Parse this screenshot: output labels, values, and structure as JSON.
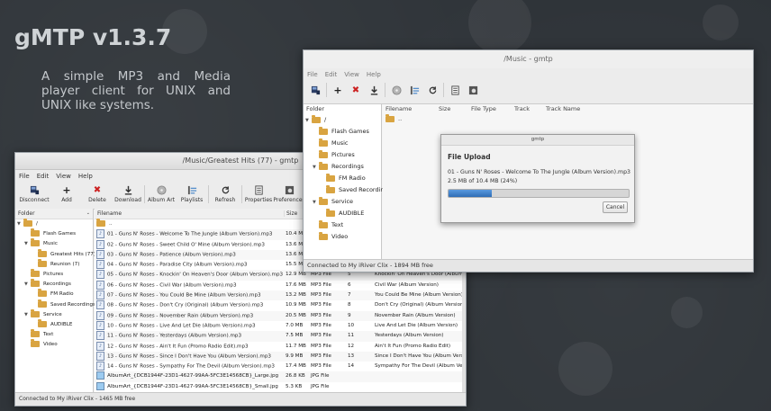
{
  "app": {
    "title": "gMTP v1.3.7",
    "description": "A simple MP3 and Media player client for UNIX and UNIX like systems."
  },
  "colors": {
    "accent": "#3d7fc6",
    "background": "#2e3338",
    "folder": "#d9a441",
    "delete": "#cc2222"
  },
  "window_large": {
    "title": "/Music/Greatest Hits (77) - gmtp",
    "menu": [
      "File",
      "Edit",
      "View",
      "Help"
    ],
    "toolbar": [
      {
        "label": "Disconnect",
        "icon": "disconnect-icon"
      },
      {
        "label": "Add",
        "icon": "add-icon"
      },
      {
        "label": "Delete",
        "icon": "delete-icon"
      },
      {
        "label": "Download",
        "icon": "download-icon"
      },
      {
        "label": "Album Art",
        "icon": "album-art-icon"
      },
      {
        "label": "Playlists",
        "icon": "playlists-icon"
      },
      {
        "label": "Refresh",
        "icon": "refresh-icon"
      },
      {
        "label": "Properties",
        "icon": "properties-icon"
      },
      {
        "label": "Preferences",
        "icon": "preferences-icon"
      }
    ],
    "folder_header": "Folder",
    "folders": [
      {
        "label": "/",
        "level": 0,
        "expanded": true
      },
      {
        "label": "Flash Games",
        "level": 1
      },
      {
        "label": "Music",
        "level": 1,
        "expanded": true
      },
      {
        "label": "Greatest Hits (77)",
        "level": 2
      },
      {
        "label": "Reunion (7)",
        "level": 2
      },
      {
        "label": "Pictures",
        "level": 1
      },
      {
        "label": "Recordings",
        "level": 1,
        "expanded": true
      },
      {
        "label": "FM Radio",
        "level": 2
      },
      {
        "label": "Saved Recordings",
        "level": 2
      },
      {
        "label": "Service",
        "level": 1,
        "expanded": true
      },
      {
        "label": "AUDIBLE",
        "level": 2
      },
      {
        "label": "Text",
        "level": 1
      },
      {
        "label": "Video",
        "level": 1
      }
    ],
    "columns": [
      "Filename",
      "Size"
    ],
    "files": [
      {
        "name": "..",
        "size": "",
        "type": "",
        "track": "",
        "title": "",
        "kind": "folder"
      },
      {
        "name": "01 - Guns N' Roses - Welcome To The Jungle (Album Version).mp3",
        "size": "10.4 MB",
        "type": "",
        "track": "",
        "title": "",
        "kind": "music"
      },
      {
        "name": "02 - Guns N' Roses - Sweet Child O' Mine (Album Version).mp3",
        "size": "13.6 MB",
        "type": "",
        "track": "",
        "title": "",
        "kind": "music"
      },
      {
        "name": "03 - Guns N' Roses - Patience (Album Version).mp3",
        "size": "13.6 MB",
        "type": "",
        "track": "",
        "title": "",
        "kind": "music"
      },
      {
        "name": "04 - Guns N' Roses - Paradise City (Album Version).mp3",
        "size": "15.5 MB",
        "type": "",
        "track": "",
        "title": "",
        "kind": "music"
      },
      {
        "name": "05 - Guns N' Roses - Knockin' On Heaven's Door (Album Version).mp3",
        "size": "12.9 MB",
        "type": "MP3 File",
        "track": "5",
        "title": "Knockin' On Heaven's Door (Album Version)",
        "kind": "music"
      },
      {
        "name": "06 - Guns N' Roses - Civil War (Album Version).mp3",
        "size": "17.6 MB",
        "type": "MP3 File",
        "track": "6",
        "title": "Civil War (Album Version)",
        "kind": "music"
      },
      {
        "name": "07 - Guns N' Roses - You Could Be Mine (Album Version).mp3",
        "size": "13.2 MB",
        "type": "MP3 File",
        "track": "7",
        "title": "You Could Be Mine (Album Version)",
        "kind": "music"
      },
      {
        "name": "08 - Guns N' Roses - Don't Cry (Original) (Album Version).mp3",
        "size": "10.9 MB",
        "type": "MP3 File",
        "track": "8",
        "title": "Don't Cry (Original) (Album Version)",
        "kind": "music"
      },
      {
        "name": "09 - Guns N' Roses - November Rain (Album Version).mp3",
        "size": "20.5 MB",
        "type": "MP3 File",
        "track": "9",
        "title": "November Rain (Album Version)",
        "kind": "music"
      },
      {
        "name": "10 - Guns N' Roses - Live And Let Die (Album Version).mp3",
        "size": "7.0 MB",
        "type": "MP3 File",
        "track": "10",
        "title": "Live And Let Die (Album Version)",
        "kind": "music"
      },
      {
        "name": "11 - Guns N' Roses - Yesterdays (Album Version).mp3",
        "size": "7.5 MB",
        "type": "MP3 File",
        "track": "11",
        "title": "Yesterdays (Album Version)",
        "kind": "music"
      },
      {
        "name": "12 - Guns N' Roses - Ain't It Fun (Promo Radio Edit).mp3",
        "size": "11.7 MB",
        "type": "MP3 File",
        "track": "12",
        "title": "Ain't It Fun (Promo Radio Edit)",
        "kind": "music"
      },
      {
        "name": "13 - Guns N' Roses - Since I Don't Have You (Album Version).mp3",
        "size": "9.9 MB",
        "type": "MP3 File",
        "track": "13",
        "title": "Since I Don't Have You (Album Version)",
        "kind": "music"
      },
      {
        "name": "14 - Guns N' Roses - Sympathy For The Devil (Album Version).mp3",
        "size": "17.4 MB",
        "type": "MP3 File",
        "track": "14",
        "title": "Sympathy For The Devil (Album Version)",
        "kind": "music"
      },
      {
        "name": "AlbumArt_{DCB1944F-23D1-4627-99AA-5FC3E14568CB}_Large.jpg",
        "size": "26.8 KB",
        "type": "JPG File",
        "track": "",
        "title": "",
        "kind": "image"
      },
      {
        "name": "AlbumArt_{DCB1944F-23D1-4627-99AA-5FC3E14568CB}_Small.jpg",
        "size": "5.3 KB",
        "type": "JPG File",
        "track": "",
        "title": "",
        "kind": "image"
      }
    ],
    "status": "Connected to My iRiver Clix - 1465 MB free"
  },
  "window_small": {
    "title": "/Music - gmtp",
    "menu": [
      "File",
      "Edit",
      "View",
      "Help"
    ],
    "toolbar_icons": [
      "disconnect-icon",
      "add-icon",
      "delete-icon",
      "download-icon",
      "album-art-icon",
      "playlists-icon",
      "refresh-icon",
      "properties-icon",
      "preferences-icon"
    ],
    "folder_header": "Folder",
    "folders": [
      {
        "label": "/",
        "level": 0,
        "expanded": true
      },
      {
        "label": "Flash Games",
        "level": 1
      },
      {
        "label": "Music",
        "level": 1
      },
      {
        "label": "Pictures",
        "level": 1
      },
      {
        "label": "Recordings",
        "level": 1,
        "expanded": true
      },
      {
        "label": "FM Radio",
        "level": 2
      },
      {
        "label": "Saved Recordings",
        "level": 2
      },
      {
        "label": "Service",
        "level": 1,
        "expanded": true
      },
      {
        "label": "AUDIBLE",
        "level": 2
      },
      {
        "label": "Text",
        "level": 1
      },
      {
        "label": "Video",
        "level": 1
      }
    ],
    "columns": [
      "Filename",
      "Size",
      "File Type",
      "Track",
      "Track Name"
    ],
    "files": [
      {
        "name": ".."
      }
    ],
    "status": "Connected to My iRiver Clix - 1894 MB free"
  },
  "dialog": {
    "title": "gmtp",
    "heading": "File Upload",
    "filename": "01 - Guns N' Roses - Welcome To The Jungle (Album Version).mp3",
    "progress_text": "2.5 MB of 10.4 MB (24%)",
    "progress": 0.24,
    "cancel_label": "Cancel"
  }
}
